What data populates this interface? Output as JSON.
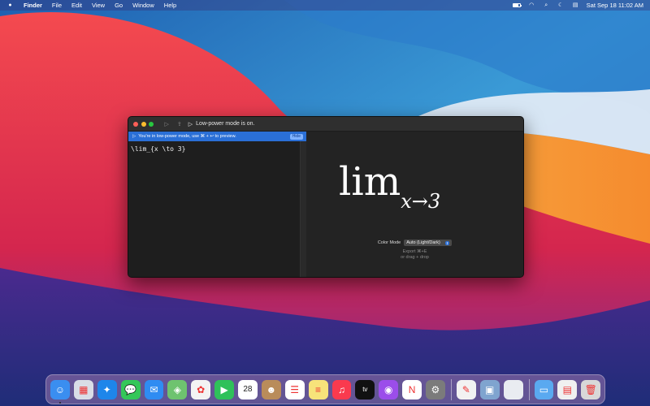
{
  "menubar": {
    "apple": "",
    "app_name": "Finder",
    "menus": [
      "File",
      "Edit",
      "View",
      "Go",
      "Window",
      "Help"
    ],
    "status_icons": [
      "battery-icon",
      "wifi-icon",
      "search-icon",
      "moon-icon",
      "control-center-icon"
    ],
    "clock": "Sat Sep 18  11:02 AM"
  },
  "window": {
    "status_text": "Low-power mode is on.",
    "banner": {
      "text": "You're in low-power mode, use ⌘ + ↩ to preview.",
      "hide_label": "Hide"
    },
    "editor": {
      "code": "\\lim_{x \\to 3}"
    },
    "preview": {
      "math_main": "lim",
      "math_sub": "x→3",
      "color_mode_label": "Color Mode",
      "color_mode_value": "Auto (Light/Dark)",
      "export_hint": "Export ⌘+E",
      "drag_hint": "or drag + drop"
    }
  },
  "dock": {
    "apps": [
      {
        "name": "finder",
        "color": "#3a8ef0",
        "glyph": "☺"
      },
      {
        "name": "launchpad",
        "color": "#d9dde6",
        "glyph": "▦"
      },
      {
        "name": "safari",
        "color": "#1e86ea",
        "glyph": "✦"
      },
      {
        "name": "messages",
        "color": "#34c759",
        "glyph": "💬"
      },
      {
        "name": "mail",
        "color": "#2f8cf2",
        "glyph": "✉"
      },
      {
        "name": "maps",
        "color": "#6ec36f",
        "glyph": "◈"
      },
      {
        "name": "photos",
        "color": "#f3f3f3",
        "glyph": "✿"
      },
      {
        "name": "facetime",
        "color": "#2fc15a",
        "glyph": "▶"
      },
      {
        "name": "calendar",
        "color": "#ffffff",
        "glyph": "28"
      },
      {
        "name": "contacts",
        "color": "#b98c5a",
        "glyph": "☻"
      },
      {
        "name": "reminders",
        "color": "#ffffff",
        "glyph": "☰"
      },
      {
        "name": "notes",
        "color": "#f7e37a",
        "glyph": "≡"
      },
      {
        "name": "music",
        "color": "#fa3a4e",
        "glyph": "♫"
      },
      {
        "name": "tv",
        "color": "#111111",
        "glyph": "tv"
      },
      {
        "name": "podcasts",
        "color": "#9b4dea",
        "glyph": "◉"
      },
      {
        "name": "news",
        "color": "#ffffff",
        "glyph": "N"
      },
      {
        "name": "system-preferences",
        "color": "#7b7b7b",
        "glyph": "⚙"
      }
    ],
    "extras": [
      {
        "name": "textedit",
        "color": "#f2f2f2",
        "glyph": "✎"
      },
      {
        "name": "preview",
        "color": "#7fa4cf",
        "glyph": "▣"
      },
      {
        "name": "blank-app",
        "color": "#e9ecf1",
        "glyph": ""
      }
    ],
    "folders": [
      {
        "name": "downloads-folder",
        "color": "#5aa9f0",
        "glyph": "▭"
      },
      {
        "name": "documents-stack",
        "color": "#f0f0f0",
        "glyph": "▤"
      },
      {
        "name": "trash",
        "color": "#d8d8d8",
        "glyph": "🗑"
      }
    ]
  }
}
